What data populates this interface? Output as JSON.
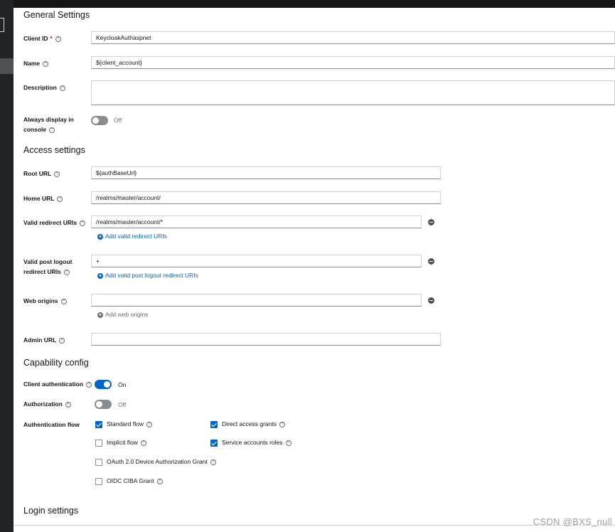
{
  "general": {
    "title": "General Settings",
    "client_id_label": "Client ID",
    "client_id_required": "*",
    "client_id_value": "KeycloakAuthaspnet",
    "name_label": "Name",
    "name_value": "${client_account}",
    "description_label": "Description",
    "description_value": "",
    "always_display_label_1": "Always display in",
    "always_display_label_2": "console",
    "always_display_state": "Off"
  },
  "access": {
    "title": "Access settings",
    "root_url_label": "Root URL",
    "root_url_value": "${authBaseUrl}",
    "home_url_label": "Home URL",
    "home_url_value": "/realms/master/account/",
    "valid_redirect_label": "Valid redirect URIs",
    "valid_redirect_value": "/realms/master/account/*",
    "add_valid_redirect": "Add valid redirect URIs",
    "post_logout_label_1": "Valid post logout",
    "post_logout_label_2": "redirect URIs",
    "post_logout_value": "+",
    "add_post_logout": "Add valid post logout redirect URIs",
    "web_origins_label": "Web origins",
    "web_origins_value": "",
    "add_web_origins": "Add web origins",
    "admin_url_label": "Admin URL",
    "admin_url_value": ""
  },
  "capability": {
    "title": "Capability config",
    "client_auth_label": "Client authentication",
    "client_auth_state": "On",
    "authorization_label": "Authorization",
    "authorization_state": "Off",
    "auth_flow_label": "Authentication flow",
    "flows": {
      "standard": {
        "label": "Standard flow",
        "checked": true
      },
      "direct": {
        "label": "Direct access grants",
        "checked": true
      },
      "implicit": {
        "label": "Implicit flow",
        "checked": false
      },
      "service": {
        "label": "Service accounts roles",
        "checked": true
      },
      "device": {
        "label": "OAuth 2.0 Device Authorization Grant",
        "checked": false
      },
      "ciba": {
        "label": "OIDC CIBA Grant",
        "checked": false
      }
    }
  },
  "login": {
    "title": "Login settings"
  },
  "watermark": "CSDN @BXS_null",
  "colors": {
    "accent": "#0066cc",
    "nav_bg": "#212427"
  }
}
